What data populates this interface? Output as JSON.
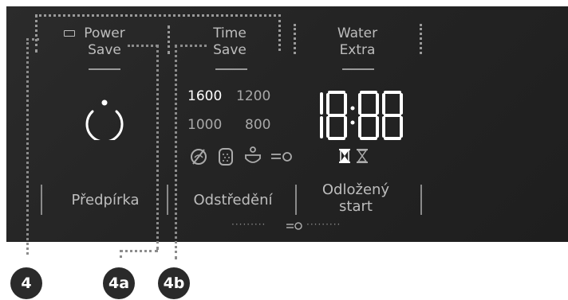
{
  "buttons": {
    "power_save": {
      "label": "Power\nSave"
    },
    "time_save": {
      "label": "Time\nSave"
    },
    "water_extra": {
      "label": "Water\nExtra"
    },
    "prewash": {
      "label": "Předpírka"
    },
    "spin": {
      "label": "Odstředění"
    },
    "delay_start": {
      "label": "Odložený\nstart"
    }
  },
  "spin_speeds": [
    {
      "value": "1600",
      "active": true
    },
    {
      "value": "1200",
      "active": false
    },
    {
      "value": "1000",
      "active": false
    },
    {
      "value": "800",
      "active": false
    }
  ],
  "display": {
    "time": "18:88"
  },
  "icons": [
    "no-spin-icon",
    "drum-icon",
    "rinse-hold-icon",
    "child-lock-icon",
    "hourglass-filled-icon",
    "hourglass-empty-icon",
    "power-icon",
    "lock-key-icon"
  ],
  "callouts": {
    "c4": "4",
    "c4a": "4a",
    "c4b": "4b"
  },
  "colors": {
    "panel": "#262626",
    "text": "#bdbdbd",
    "active": "#ffffff",
    "badge": "#2a2a2a"
  }
}
